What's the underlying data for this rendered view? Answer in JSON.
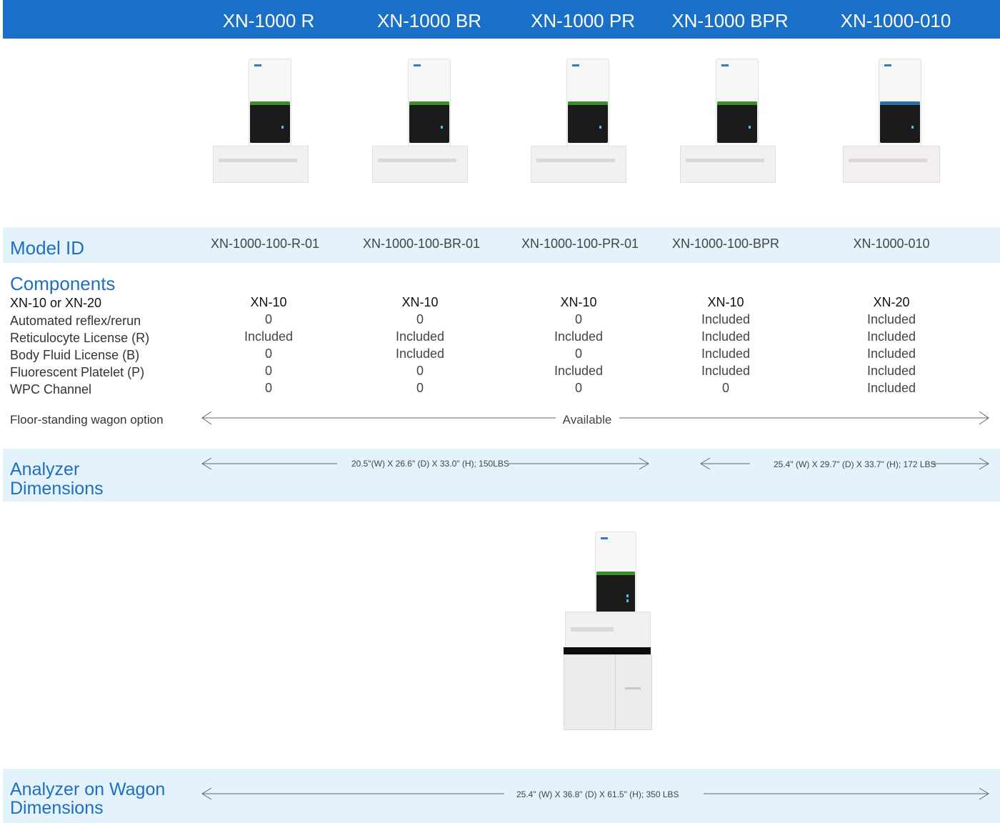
{
  "models": [
    {
      "title": "XN-1000 R",
      "model_id": "XN-1000-100-R-01",
      "xn": "XN-10",
      "reflex": "0",
      "retic": "Included",
      "body_fluid": "0",
      "fluor_plt": "0",
      "wpc": "0"
    },
    {
      "title": "XN-1000 BR",
      "model_id": "XN-1000-100-BR-01",
      "xn": "XN-10",
      "reflex": "0",
      "retic": "Included",
      "body_fluid": "Included",
      "fluor_plt": "0",
      "wpc": "0"
    },
    {
      "title": "XN-1000 PR",
      "model_id": "XN-1000-100-PR-01",
      "xn": "XN-10",
      "reflex": "0",
      "retic": "Included",
      "body_fluid": "0",
      "fluor_plt": "Included",
      "wpc": "0"
    },
    {
      "title": "XN-1000 BPR",
      "model_id": "XN-1000-100-BPR",
      "xn": "XN-10",
      "reflex": "Included",
      "retic": "Included",
      "body_fluid": "Included",
      "fluor_plt": "Included",
      "wpc": "0"
    },
    {
      "title": "XN-1000-010",
      "model_id": "XN-1000-010",
      "xn": "XN-20",
      "reflex": "Included",
      "retic": "Included",
      "body_fluid": "Included",
      "fluor_plt": "Included",
      "wpc": "Included"
    }
  ],
  "labels": {
    "model_id": "Model ID",
    "components": "Components",
    "xn": "XN-10 or XN-20",
    "reflex": "Automated reflex/rerun",
    "retic": "Reticulocyte License (R)",
    "body_fluid": "Body Fluid License (B)",
    "fluor_plt": "Fluorescent Platelet (P)",
    "wpc": "WPC Channel",
    "wagon_option": "Floor-standing wagon option",
    "analyzer_dim_line1": "Analyzer",
    "analyzer_dim_line2": "Dimensions",
    "wagon_dim_line1": "Analyzer on Wagon",
    "wagon_dim_line2": "Dimensions"
  },
  "values": {
    "wagon_available": "Available",
    "dim_xn10": "20.5\"(W) X 26.6\" (D) X 33.0\" (H); 150LBS",
    "dim_xn20": "25.4\" (W) X 29.7\" (D) X 33.7\" (H); 172 LBS",
    "dim_wagon": "25.4\" (W) X 36.8\" (D) X 61.5\" (H); 350 LBS"
  },
  "colors": {
    "header_blue": "#1a6fc9",
    "heading_blue": "#1f6ec2",
    "band_light_blue": "#e4f2fb"
  }
}
